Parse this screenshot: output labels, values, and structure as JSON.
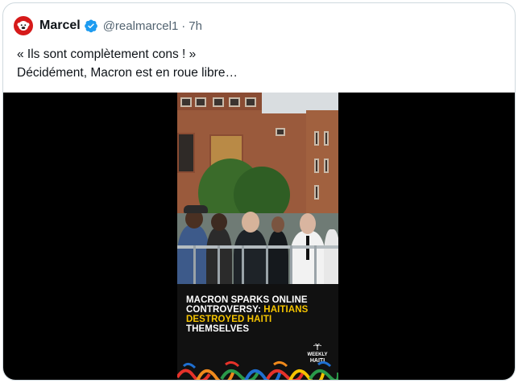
{
  "post": {
    "author_name": "Marcel",
    "handle": "@realmarcel1",
    "separator": "·",
    "time": "7h",
    "lines": [
      "« Ils sont complètement cons ! »",
      "Décidément, Macron est en roue libre…"
    ]
  },
  "video": {
    "caption_line1": "MACRON SPARKS ONLINE",
    "caption_line2_a": "CONTROVERSY: ",
    "caption_line2_b": "HAITIANS",
    "caption_line3_a": "DESTROYED HAITI",
    "caption_line3_b": " THEMSELVES",
    "brand_line1": "WEEKLY",
    "brand_line2": "HAITI"
  },
  "colors": {
    "verified": "#1d9bf0",
    "avatar_bg": "#d61a1a",
    "caption_highlight": "#f5c400"
  },
  "icons": {
    "verified": "verified-badge-icon",
    "avatar": "monkey-avatar-icon",
    "brand": "palm-tree-logo-icon"
  }
}
